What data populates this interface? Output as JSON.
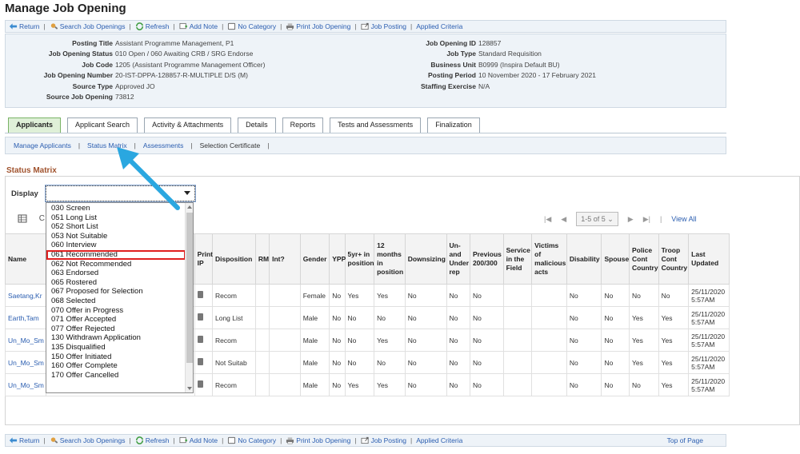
{
  "page_title": "Manage Job Opening",
  "toolbar": {
    "return": "Return",
    "search": "Search Job Openings",
    "refresh": "Refresh",
    "add_note": "Add Note",
    "no_category": "No Category",
    "print_job_opening": "Print Job Opening",
    "job_posting": "Job Posting",
    "applied_criteria": "Applied Criteria",
    "top_of_page": "Top of Page"
  },
  "job": {
    "left": [
      {
        "label": "Posting Title",
        "value": "Assistant Programme Management, P1"
      },
      {
        "label": "Job Opening Status",
        "value": "010 Open / 060 Awaiting CRB / SRG Endorse"
      },
      {
        "label": "Job Code",
        "value": "1205 (Assistant Programme Management Officer)"
      },
      {
        "label": "Job Opening Number",
        "value": "20-IST-DPPA-128857-R-MULTIPLE D/S (M)"
      },
      {
        "label": "Source Type",
        "value": "Approved JO"
      },
      {
        "label": "Source Job Opening",
        "value": "73812"
      }
    ],
    "right": [
      {
        "label": "Job Opening ID",
        "value": "128857"
      },
      {
        "label": "Job Type",
        "value": "Standard Requisition"
      },
      {
        "label": "Business Unit",
        "value": "B0999 (Inspira Default BU)"
      },
      {
        "label": "Posting Period",
        "value": "10 November 2020 - 17 February 2021"
      },
      {
        "label": "Staffing Exercise",
        "value": "N/A"
      }
    ]
  },
  "tabs": [
    "Applicants",
    "Applicant Search",
    "Activity & Attachments",
    "Details",
    "Reports",
    "Tests and Assessments",
    "Finalization"
  ],
  "subnav": {
    "manage_applicants": "Manage Applicants",
    "status_matrix": "Status Matrix",
    "assessments": "Assessments",
    "selection_certificate": "Selection Certificate"
  },
  "section_title": "Status Matrix",
  "display_label": "Display",
  "display_value": "",
  "dropdown_options": [
    "030 Screen",
    "051 Long List",
    "052 Short List",
    "053 Not Suitable",
    "060 Interview",
    "061 Recommended",
    "062 Not Recommended",
    "063 Endorsed",
    "065 Rostered",
    "067 Proposed for Selection",
    "068 Selected",
    "070 Offer in Progress",
    "071 Offer Accepted",
    "077 Offer Rejected",
    "130 Withdrawn Application",
    "135 Disqualified",
    "150 Offer Initiated",
    "160 Offer Complete",
    "170 Offer Cancelled"
  ],
  "highlighted_option": "061 Recommended",
  "pager": {
    "range": "1-5 of 5",
    "view_all": "View All"
  },
  "grid_tools_char": "C",
  "columns": [
    "Name",
    "",
    "Print IP",
    "Disposition",
    "RM",
    "Int?",
    "Gender",
    "YPP",
    "5yr+ in position",
    "12 months in position",
    "Downsizing",
    "Un-and Under rep",
    "Previous 200/300",
    "Service in the Field",
    "Victims of malicious acts",
    "Disability",
    "Spouse",
    "Police Cont Country",
    "Troop Cont Country",
    "Last Updated"
  ],
  "rows": [
    {
      "name": "Saetang,Kr",
      "disposition": "Recom",
      "rm": "",
      "int": "",
      "gender": "Female",
      "ypp": "No",
      "five_yr": "Yes",
      "twelve_m": "Yes",
      "downsizing": "No",
      "unrep": "No",
      "prev": "No",
      "service": "",
      "victims": "",
      "disability": "No",
      "spouse": "No",
      "police": "No",
      "troop": "No",
      "updated": "25/11/2020 5:57AM"
    },
    {
      "name": "Earth,Tam",
      "disposition": "Long List",
      "rm": "",
      "int": "",
      "gender": "Male",
      "ypp": "No",
      "five_yr": "No",
      "twelve_m": "No",
      "downsizing": "No",
      "unrep": "No",
      "prev": "No",
      "service": "",
      "victims": "",
      "disability": "No",
      "spouse": "No",
      "police": "Yes",
      "troop": "Yes",
      "updated": "25/11/2020 5:57AM"
    },
    {
      "name": "Un_Mo_Sm",
      "disposition": "Recom",
      "rm": "",
      "int": "",
      "gender": "Male",
      "ypp": "No",
      "five_yr": "No",
      "twelve_m": "Yes",
      "downsizing": "No",
      "unrep": "No",
      "prev": "No",
      "service": "",
      "victims": "",
      "disability": "No",
      "spouse": "No",
      "police": "Yes",
      "troop": "Yes",
      "updated": "25/11/2020 5:57AM"
    },
    {
      "name": "Un_Mo_Sm",
      "disposition": "Not Suitab",
      "rm": "",
      "int": "",
      "gender": "Male",
      "ypp": "No",
      "five_yr": "No",
      "twelve_m": "No",
      "downsizing": "No",
      "unrep": "No",
      "prev": "No",
      "service": "",
      "victims": "",
      "disability": "No",
      "spouse": "No",
      "police": "Yes",
      "troop": "Yes",
      "updated": "25/11/2020 5:57AM"
    },
    {
      "name": "Un_Mo_Sm",
      "disposition": "Recom",
      "rm": "",
      "int": "",
      "gender": "Male",
      "ypp": "No",
      "five_yr": "Yes",
      "twelve_m": "Yes",
      "downsizing": "No",
      "unrep": "No",
      "prev": "No",
      "service": "",
      "victims": "",
      "disability": "No",
      "spouse": "No",
      "police": "No",
      "troop": "Yes",
      "updated": "25/11/2020 5:57AM"
    }
  ]
}
